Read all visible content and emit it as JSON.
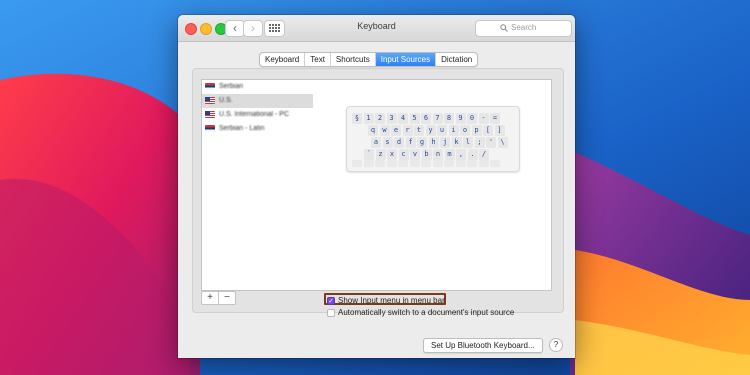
{
  "window": {
    "title": "Keyboard",
    "search_placeholder": "Search"
  },
  "toolbar": {
    "back_glyph": "‹",
    "forward_glyph": "›"
  },
  "tabs": [
    {
      "label": "Keyboard",
      "active": false
    },
    {
      "label": "Text",
      "active": false
    },
    {
      "label": "Shortcuts",
      "active": false
    },
    {
      "label": "Input Sources",
      "active": true
    },
    {
      "label": "Dictation",
      "active": false
    }
  ],
  "input_sources": [
    {
      "label": "Serbian",
      "flag": "serbian-flag-icon",
      "selected": false
    },
    {
      "label": "U.S.",
      "flag": "us-flag-icon",
      "selected": true
    },
    {
      "label": "U.S. International - PC",
      "flag": "us-flag-icon",
      "selected": false
    },
    {
      "label": "Serbian - Latin",
      "flag": "serbian-flag-icon",
      "selected": false
    }
  ],
  "list_controls": {
    "add": "+",
    "remove": "−"
  },
  "keyboard_preview": {
    "row1": [
      "§",
      "1",
      "2",
      "3",
      "4",
      "5",
      "6",
      "7",
      "8",
      "9",
      "0",
      "-",
      "="
    ],
    "row2": [
      "q",
      "w",
      "e",
      "r",
      "t",
      "y",
      "u",
      "i",
      "o",
      "p",
      "[",
      "]"
    ],
    "row3": [
      "a",
      "s",
      "d",
      "f",
      "g",
      "h",
      "j",
      "k",
      "l",
      ";",
      "'",
      "\\"
    ],
    "row4": [
      "`",
      "z",
      "x",
      "c",
      "v",
      "b",
      "n",
      "m",
      ",",
      ".",
      "/"
    ]
  },
  "options": {
    "show_input_menu": {
      "label": "Show Input menu in menu bar",
      "checked": true
    },
    "auto_switch": {
      "label": "Automatically switch to a document's input source",
      "checked": false
    }
  },
  "footer": {
    "bluetooth_button": "Set Up Bluetooth Keyboard...",
    "help": "?"
  },
  "colors": {
    "accent": "#2d82f3",
    "checkbox_checked": "#7b49d6",
    "highlight_border": "#7a3a18"
  }
}
